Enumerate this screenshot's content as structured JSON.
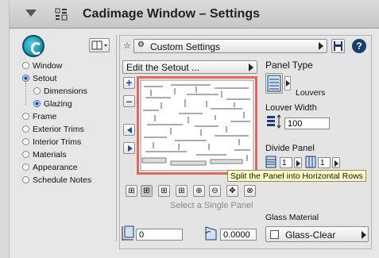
{
  "header": {
    "title": "Cadimage Window – Settings"
  },
  "sidebar": {
    "items": [
      {
        "label": "Window",
        "selected": false,
        "indent": 0
      },
      {
        "label": "Setout",
        "selected": true,
        "indent": 0
      },
      {
        "label": "Dimensions",
        "selected": false,
        "indent": 1
      },
      {
        "label": "Glazing",
        "selected": true,
        "indent": 1
      },
      {
        "label": "Frame",
        "selected": false,
        "indent": 0
      },
      {
        "label": "Exterior Trims",
        "selected": false,
        "indent": 0
      },
      {
        "label": "Interior Trims",
        "selected": false,
        "indent": 0
      },
      {
        "label": "Materials",
        "selected": false,
        "indent": 0
      },
      {
        "label": "Appearance",
        "selected": false,
        "indent": 0
      },
      {
        "label": "Schedule Notes",
        "selected": false,
        "indent": 0
      }
    ]
  },
  "settings": {
    "value": "Custom Settings"
  },
  "setout": {
    "menu_label": "Edit the Setout ..."
  },
  "panel_type": {
    "label": "Panel Type",
    "value": "Louvers"
  },
  "louver_width": {
    "label": "Louver Width",
    "value": "100"
  },
  "divide_panel": {
    "label": "Divide Panel",
    "rows": "1",
    "cols": "1"
  },
  "tooltip": {
    "text": "Split the Panel into Horizontal Rows"
  },
  "toolbar": {
    "hint": "Select a Single Panel"
  },
  "glass_material": {
    "label": "Glass Material",
    "value": "Glass-Clear"
  },
  "bottom": {
    "offset_value": "0",
    "angle_value": "0.0000"
  },
  "colors": {
    "highlight_border": "#e8645a",
    "tooltip_bg": "#ffffc6"
  }
}
